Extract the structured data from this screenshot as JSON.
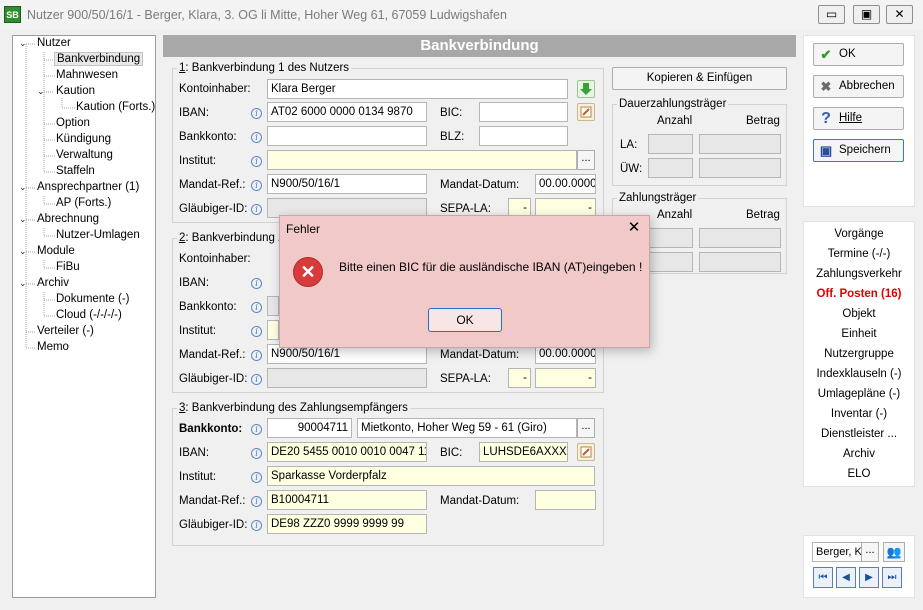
{
  "window": {
    "title": "Nutzer 900/50/16/1 - Berger, Klara, 3. OG li Mitte, Hoher Weg 61, 67059 Ludwigshafen",
    "icon_text": "SB",
    "minimize": "▭",
    "restore": "▣",
    "close": "✕"
  },
  "tree": {
    "items": [
      {
        "label": "Nutzer"
      },
      {
        "label": "Bankverbindung"
      },
      {
        "label": "Mahnwesen"
      },
      {
        "label": "Kaution"
      },
      {
        "label": "Kaution (Forts.)"
      },
      {
        "label": "Option"
      },
      {
        "label": "Kündigung"
      },
      {
        "label": "Verwaltung"
      },
      {
        "label": "Staffeln"
      },
      {
        "label": "Ansprechpartner (1)"
      },
      {
        "label": "AP (Forts.)"
      },
      {
        "label": "Abrechnung"
      },
      {
        "label": "Nutzer-Umlagen"
      },
      {
        "label": "Module"
      },
      {
        "label": "FiBu"
      },
      {
        "label": "Archiv"
      },
      {
        "label": "Dokumente (-)"
      },
      {
        "label": "Cloud (-/-/-/-)"
      },
      {
        "label": "Verteiler (-)"
      },
      {
        "label": "Memo"
      }
    ]
  },
  "main": {
    "header": "Bankverbindung",
    "info_glyph": "i",
    "dots_glyph": "...",
    "g1": {
      "title_num": "1",
      "title": ": Bankverbindung 1 des Nutzers",
      "kontoinhaber_label": "Kontoinhaber:",
      "kontoinhaber": "Klara Berger",
      "iban_label": "IBAN:",
      "iban": "AT02 6000 0000 0134 9870",
      "bic_label": "BIC:",
      "bic": "",
      "bankkonto_label": "Bankkonto:",
      "bankkonto": "",
      "blz_label": "BLZ:",
      "blz": "",
      "institut_label": "Institut:",
      "institut": "",
      "mandat_ref_label": "Mandat-Ref.:",
      "mandat_ref": "N900/50/16/1",
      "mandat_datum_label": "Mandat-Datum:",
      "mandat_datum": "00.00.0000",
      "glaeubiger_label": "Gläubiger-ID:",
      "glaeubiger": "",
      "sepa_label": "SEPA-LA:",
      "sepa_a": "-",
      "sepa_b": "-"
    },
    "g2": {
      "title_num": "2",
      "title": ": Bankverbindung 2",
      "kontoinhaber_label": "Kontoinhaber:",
      "iban_label": "IBAN:",
      "bankkonto_label": "Bankkonto:",
      "institut_label": "Institut:",
      "mandat_ref_label": "Mandat-Ref.:",
      "mandat_ref": "N900/50/16/1",
      "mandat_datum_label": "Mandat-Datum:",
      "mandat_datum": "00.00.0000",
      "glaeubiger_label": "Gläubiger-ID:",
      "sepa_label": "SEPA-LA:",
      "sepa_a": "-",
      "sepa_b": "-"
    },
    "g3": {
      "title_num": "3",
      "title": ": Bankverbindung des Zahlungsempfängers",
      "bankkonto_label": "Bankkonto:",
      "bankkonto": "90004711",
      "bankkonto_desc": "Mietkonto,  Hoher Weg 59 - 61 (Giro)",
      "iban_label": "IBAN:",
      "iban": "DE20 5455 0010 0010 0047 11",
      "bic_label": "BIC:",
      "bic": "LUHSDE6AXXX",
      "institut_label": "Institut:",
      "institut": "Sparkasse Vorderpfalz",
      "mandat_ref_label": "Mandat-Ref.:",
      "mandat_ref": "B10004711",
      "mandat_datum_label": "Mandat-Datum:",
      "mandat_datum": "",
      "glaeubiger_label": "Gläubiger-ID:",
      "glaeubiger": "DE98 ZZZ0 9999 9999 99"
    },
    "copy_button": "Kopieren & Einfügen",
    "dauer": {
      "title": "Dauerzahlungsträger",
      "anzahl": "Anzahl",
      "betrag": "Betrag",
      "la": "LA:",
      "uew": "ÜW:"
    },
    "zahlung": {
      "title": "Zahlungsträger",
      "anzahl": "Anzahl",
      "betrag": "Betrag"
    }
  },
  "right": {
    "ok": "OK",
    "cancel": "Abbrechen",
    "help": "Hilfe",
    "save": "Speichern",
    "links": [
      "Vorgänge",
      "Termine (-/-)",
      "Zahlungsverkehr",
      "Off. Posten (16)",
      "Objekt",
      "Einheit",
      "Nutzergruppe",
      "Indexklauseln (-)",
      "Umlagepläne (-)",
      "Inventar (-)",
      "Dienstleister ...",
      "Archiv",
      "ELO"
    ],
    "highlight_color": "#e00000",
    "user_field": "Berger, K",
    "nav_first": "⏮",
    "nav_prev": "◀",
    "nav_next": "▶",
    "nav_last": "⏭"
  },
  "dialog": {
    "title": "Fehler",
    "message": "Bitte einen BIC für die ausländische IBAN (AT)eingeben !",
    "ok": "OK",
    "close": "✕",
    "icon": "✕"
  }
}
